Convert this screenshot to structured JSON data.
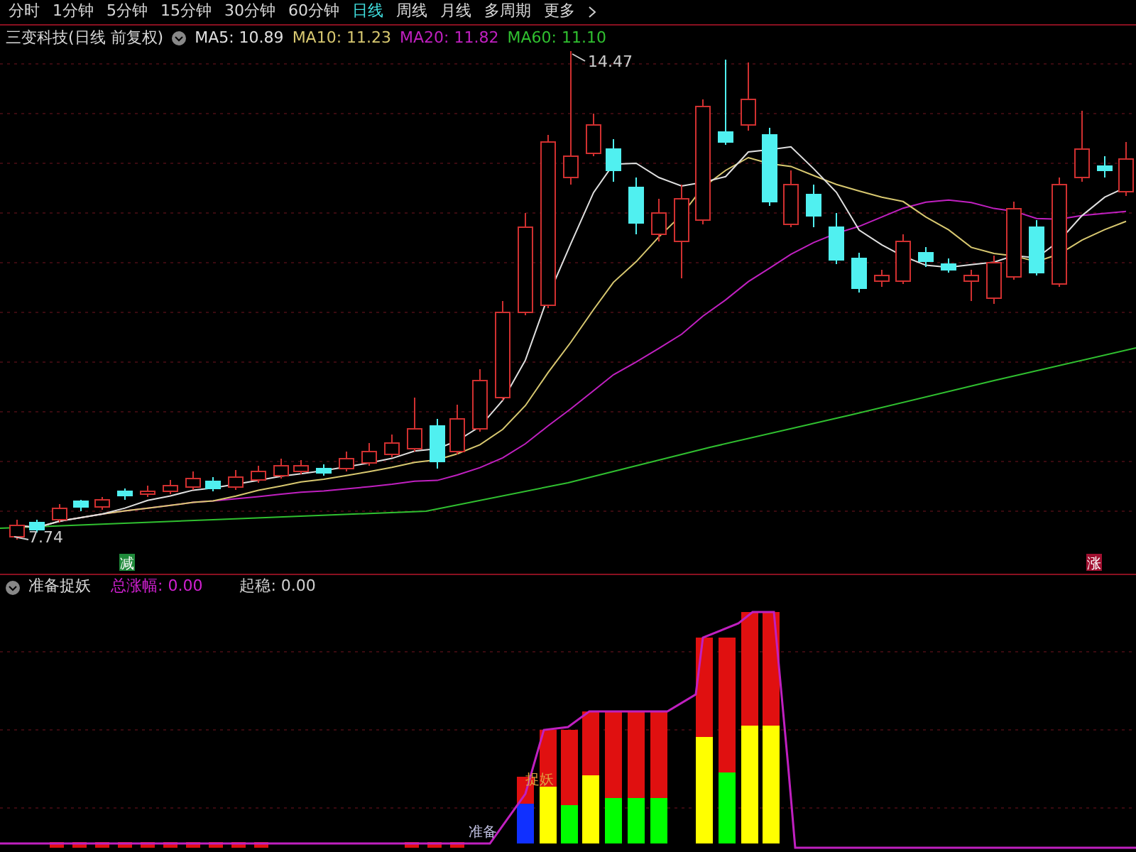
{
  "tabs": [
    {
      "label": "分时",
      "selected": false
    },
    {
      "label": "1分钟",
      "selected": false
    },
    {
      "label": "5分钟",
      "selected": false
    },
    {
      "label": "15分钟",
      "selected": false
    },
    {
      "label": "30分钟",
      "selected": false
    },
    {
      "label": "60分钟",
      "selected": false
    },
    {
      "label": "日线",
      "selected": true
    },
    {
      "label": "周线",
      "selected": false
    },
    {
      "label": "月线",
      "selected": false
    },
    {
      "label": "多周期",
      "selected": false
    },
    {
      "label": "更多",
      "selected": false
    }
  ],
  "legend": {
    "title": "三变科技(日线 前复权)",
    "ma": [
      {
        "label": "MA5: 10.89",
        "color": "#e0e0e0"
      },
      {
        "label": "MA10: 11.23",
        "color": "#d8c870"
      },
      {
        "label": "MA20: 11.82",
        "color": "#c020c0"
      },
      {
        "label": "MA60: 11.10",
        "color": "#30c030"
      }
    ]
  },
  "chart": {
    "high_label": "14.47",
    "low_label": "7.74",
    "markers": [
      {
        "text": "减",
        "color": "#1f8a3a"
      },
      {
        "text": "涨",
        "color": "#a01030"
      }
    ]
  },
  "indicator": {
    "title": "准备捉妖",
    "values": [
      {
        "label": "总涨幅: 0.00",
        "color": "#d020d0"
      },
      {
        "label": "起稳: 0.00",
        "color": "#d0d0d0"
      }
    ],
    "labels": [
      "捉妖",
      "准备"
    ]
  }
}
